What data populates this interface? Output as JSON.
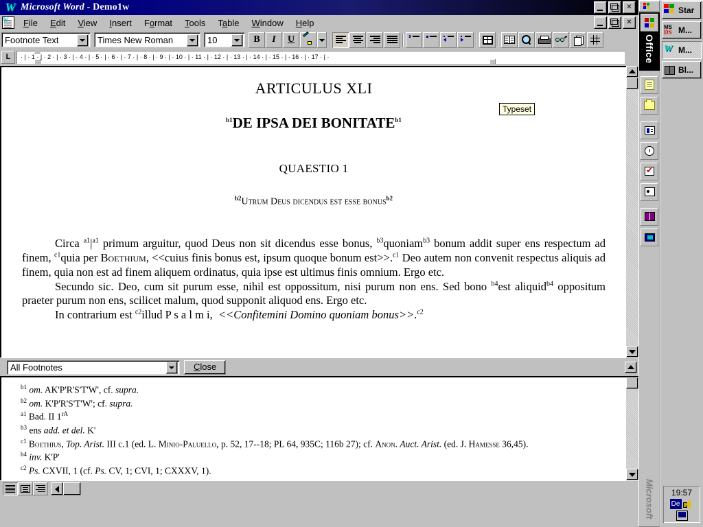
{
  "window": {
    "title_app": "Microsoft Word",
    "title_sep": " - ",
    "title_doc": "Demo1w",
    "app_icon": "word-w-icon",
    "minimize_label": "Minimize",
    "maximize_label": "Restore",
    "close_label": "Close"
  },
  "menubar": {
    "items": [
      {
        "label": "File",
        "accel": "F"
      },
      {
        "label": "Edit",
        "accel": "E"
      },
      {
        "label": "View",
        "accel": "V"
      },
      {
        "label": "Insert",
        "accel": "I"
      },
      {
        "label": "Format",
        "accel": "o"
      },
      {
        "label": "Tools",
        "accel": "T"
      },
      {
        "label": "Table",
        "accel": "a"
      },
      {
        "label": "Window",
        "accel": "W"
      },
      {
        "label": "Help",
        "accel": "H"
      }
    ]
  },
  "toolbar": {
    "style_value": "Footnote Text",
    "font_value": "Times New Roman",
    "size_value": "10",
    "bold_label": "B",
    "italic_label": "I",
    "underline_label": "U",
    "buttons": [
      {
        "name": "highlight-button",
        "icon": "highlighter-icon"
      },
      {
        "name": "highlight-dropdown",
        "icon": "chevron-down-icon"
      },
      {
        "name": "align-left-button",
        "icon": "align-left-icon"
      },
      {
        "name": "align-center-button",
        "icon": "align-center-icon"
      },
      {
        "name": "align-right-button",
        "icon": "align-right-icon"
      },
      {
        "name": "justify-button",
        "icon": "align-justify-icon"
      },
      {
        "name": "numbered-list-button",
        "icon": "numbered-list-icon"
      },
      {
        "name": "bulleted-list-button",
        "icon": "bulleted-list-icon"
      },
      {
        "name": "decrease-indent-button",
        "icon": "decrease-indent-icon"
      },
      {
        "name": "increase-indent-button",
        "icon": "increase-indent-icon"
      },
      {
        "name": "table-button",
        "icon": "table-icon"
      },
      {
        "name": "book-button",
        "icon": "open-book-icon"
      },
      {
        "name": "find-button",
        "icon": "magnifier-icon"
      },
      {
        "name": "print-button",
        "icon": "printer-icon"
      },
      {
        "name": "typeset-button",
        "icon": "glasses-icon"
      },
      {
        "name": "copy-button",
        "icon": "copy-pages-icon"
      },
      {
        "name": "grid-button",
        "icon": "grid-icon"
      }
    ],
    "tooltip": "Typeset"
  },
  "ruler": {
    "tab_type": "L",
    "marks": "·  |  ·  1  ·  |  ·  2  ·  |  ·  3  ·  |  ·  4  ·  |  ·  5  ·  |  ·  6  ·  |  ·  7  ·  |  ·  8  ·  |  ·  9  ·  |  ·  10  ·  |  ·  11  ·  |  ·  12  ·  |  ·  13  ·  |  ·  14  ·  |  ·  15  ·  |  ·  16  ·  |  ·  17  ·  |  ·"
  },
  "document": {
    "heading1": "ARTICULUS XLI",
    "heading2_marker_open": "b1",
    "heading2": "DE IPSA DEI BONITATE",
    "heading2_marker_close": "b1",
    "heading3": "QUAESTIO 1",
    "heading4_marker_open": "b2",
    "heading4": "Utrum Deus dicendus est esse bonus",
    "heading4_marker_close": "b2",
    "paragraphs": [
      {
        "id": "para-circa",
        "html": "Circa <sup class=\"ref\">a1</sup>|<sup class=\"ref\">a1</sup> primum arguitur, quod Deus non sit dicendus esse bonus, <sup class=\"ref\">b3</sup>quoniam<sup class=\"ref\">b3</sup> bonum addit super ens respectum ad finem, <sup class=\"ref\">c1</sup>quia per <span class=\"smcap\">Boethium</span>, &lt;&lt;cuius finis bonus est, ipsum quoque bonum est&gt;&gt;.<sup class=\"ref\">c1</sup> Deo autem non convenit respectus aliquis ad finem, quia non est ad finem aliquem ordinatus, quia ipse est ultimus finis omnium. Ergo etc."
      },
      {
        "id": "para-secundo",
        "html": "Secundo sic. Deo, cum sit purum esse, nihil est oppossitum, nisi purum non ens. Sed bono <sup class=\"ref\">b4</sup>est aliquid<sup class=\"ref\">b4</sup> oppositum praeter purum non ens, scilicet malum, quod supponit aliquod ens. Ergo etc."
      },
      {
        "id": "para-incontrarium",
        "html": "In contrarium est <sup class=\"ref\">c2</sup>illud P s a l m i,&nbsp; <i>&lt;&lt;Confitemini Domino quoniam bonus&gt;&gt;</i>.<sup class=\"ref\">c2</sup>"
      }
    ]
  },
  "footnote_pane": {
    "view_selector_value": "All Footnotes",
    "close_label": "Close",
    "notes": [
      {
        "id": "fn-b1",
        "html": "<sup>b1</sup> <i>om.</i> AK'P'R'S'T'W', cf. <i>supra.</i>"
      },
      {
        "id": "fn-b2",
        "html": "<sup>b2</sup> <i>om.</i> K'P'R'S'T'W'; cf. <i>supra.</i>"
      },
      {
        "id": "fn-a1",
        "html": "<sup>a1</sup> Bad. II 1<sup>rA</sup>"
      },
      {
        "id": "fn-b3",
        "html": "<sup>b3</sup> ens <i>add. et del.</i> K'"
      },
      {
        "id": "fn-c1",
        "html": "<sup>c1</sup> <span class=\"smcap\">Boethius</span>, <i>Top. Arist.</i> III c.1 (ed. L. <span class=\"smcap\">Minio-Paluello</span>, p. 52, 17--18; PL 64, 935C; 116b 27); cf. <span class=\"smcap\">Anon</span>. <i>Auct. Arist.</i> (ed. J. <span class=\"smcap\">Hamesse</span> 36,45)."
      },
      {
        "id": "fn-b4",
        "html": "<sup>b4</sup> <i>inv.</i> K'P'"
      },
      {
        "id": "fn-c2",
        "html": "<sup>c2</sup> <i>Ps.</i> CXVII, 1 (cf. <i>Ps.</i> CV, 1; CVI, 1; CXXXV, 1)."
      }
    ]
  },
  "statusbar": {
    "view_buttons": [
      {
        "name": "normal-view-button",
        "icon": "normal-view-icon"
      },
      {
        "name": "page-layout-view-button",
        "icon": "page-layout-view-icon"
      },
      {
        "name": "outline-view-button",
        "icon": "outline-view-icon"
      }
    ]
  },
  "office_bar": {
    "label": "Office",
    "branding": "Microsoft",
    "buttons": [
      {
        "name": "new-document-button",
        "icon": "document-icon"
      },
      {
        "name": "open-document-button",
        "icon": "folder-icon"
      },
      {
        "name": "contacts-button",
        "icon": "contact-card-icon"
      },
      {
        "name": "journal-button",
        "icon": "clock-icon"
      },
      {
        "name": "tasks-button",
        "icon": "checkmark-icon"
      },
      {
        "name": "meeting-button",
        "icon": "people-icon"
      },
      {
        "name": "binder-button",
        "icon": "book-icon"
      },
      {
        "name": "answer-wizard-button",
        "icon": "screen-icon"
      }
    ]
  },
  "taskbar": {
    "start_label": "Star",
    "items": [
      {
        "name": "taskbar-start-button",
        "label": "Star",
        "icon": "windows-flag-icon",
        "active": false
      },
      {
        "name": "taskbar-item-msdos",
        "label": "M...",
        "icon": "ms-dos-icon",
        "active": false
      },
      {
        "name": "taskbar-item-word",
        "label": "M...",
        "icon": "word-w-icon",
        "active": true
      },
      {
        "name": "taskbar-item-bl",
        "label": "Bl...",
        "icon": "binoculars-icon",
        "active": false
      }
    ],
    "tray": {
      "clock": "19:57",
      "keyboard_layout": "De",
      "icons": [
        "speaker-icon",
        "monitor-icon"
      ]
    }
  },
  "colors": {
    "titlebar_blue": "#000080",
    "face": "#c0c0c0",
    "tooltip_bg": "#ffffe1",
    "accent_cyan": "#00d5d5"
  }
}
